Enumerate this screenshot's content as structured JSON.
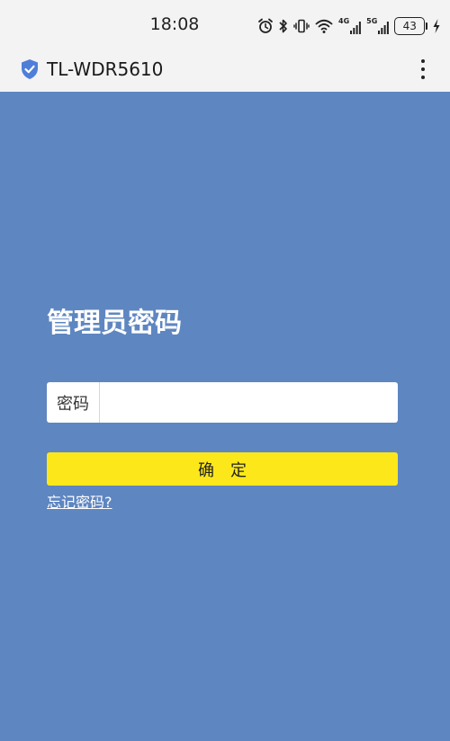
{
  "status_bar": {
    "time": "18:08",
    "cellular_1_label": "4G",
    "cellular_2_label": "5G",
    "battery": "43"
  },
  "browser": {
    "address": "TL-WDR5610",
    "icons": [
      "shield-check-icon",
      "more-vert-icon"
    ]
  },
  "login": {
    "title": "管理员密码",
    "password_label": "密码",
    "password_value": "",
    "password_placeholder": "",
    "confirm_label": "确定",
    "forgot_link": "忘记密码?"
  },
  "colors": {
    "page_background": "#5e86c1",
    "confirm_button": "#fce81a",
    "shield_icon": "#4f7ed9",
    "toolbar_background": "#f3f3f3"
  }
}
